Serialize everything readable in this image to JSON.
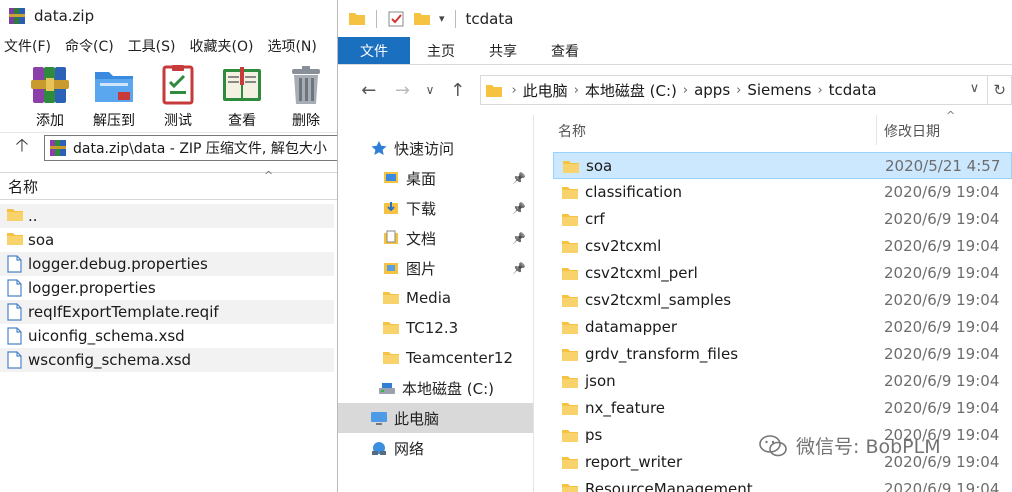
{
  "winrar": {
    "title": "data.zip",
    "menu": [
      "文件(F)",
      "命令(C)",
      "工具(S)",
      "收藏夹(O)",
      "选项(N)"
    ],
    "toolbar": [
      {
        "label": "添加",
        "icon": "add-archive-icon"
      },
      {
        "label": "解压到",
        "icon": "extract-to-icon"
      },
      {
        "label": "测试",
        "icon": "test-archive-icon"
      },
      {
        "label": "查看",
        "icon": "view-book-icon"
      },
      {
        "label": "删除",
        "icon": "delete-trash-icon"
      }
    ],
    "address": "data.zip\\data - ZIP 压缩文件, 解包大小",
    "column_name": "名称",
    "files": [
      {
        "name": "..",
        "icon": "folder-icon"
      },
      {
        "name": "soa",
        "icon": "folder-icon"
      },
      {
        "name": "logger.debug.properties",
        "icon": "file-icon"
      },
      {
        "name": "logger.properties",
        "icon": "file-icon"
      },
      {
        "name": "reqIfExportTemplate.reqif",
        "icon": "file-icon"
      },
      {
        "name": "uiconfig_schema.xsd",
        "icon": "file-icon"
      },
      {
        "name": "wsconfig_schema.xsd",
        "icon": "file-icon"
      }
    ]
  },
  "explorer": {
    "title": "tcdata",
    "ribbon_tabs": [
      "文件",
      "主页",
      "共享",
      "查看"
    ],
    "breadcrumb": [
      "此电脑",
      "本地磁盘 (C:)",
      "apps",
      "Siemens",
      "tcdata"
    ],
    "nav_pane": [
      {
        "label": "快速访问",
        "icon": "star-icon",
        "pinned": false
      },
      {
        "label": "桌面",
        "icon": "desktop-folder-icon",
        "pinned": true
      },
      {
        "label": "下载",
        "icon": "download-folder-icon",
        "pinned": true
      },
      {
        "label": "文档",
        "icon": "documents-folder-icon",
        "pinned": true
      },
      {
        "label": "图片",
        "icon": "pictures-folder-icon",
        "pinned": true
      },
      {
        "label": "Media",
        "icon": "folder-icon",
        "pinned": false
      },
      {
        "label": "TC12.3",
        "icon": "folder-icon",
        "pinned": false
      },
      {
        "label": "Teamcenter12",
        "icon": "folder-icon",
        "pinned": false
      },
      {
        "label": "本地磁盘 (C:)",
        "icon": "drive-icon",
        "pinned": false
      },
      {
        "label": "此电脑",
        "icon": "computer-icon",
        "pinned": false
      },
      {
        "label": "网络",
        "icon": "network-icon",
        "pinned": false
      }
    ],
    "column_name": "名称",
    "column_date": "修改日期",
    "files": [
      {
        "name": "soa",
        "date": "2020/5/21 4:57"
      },
      {
        "name": "classification",
        "date": "2020/6/9 19:04"
      },
      {
        "name": "crf",
        "date": "2020/6/9 19:04"
      },
      {
        "name": "csv2tcxml",
        "date": "2020/6/9 19:04"
      },
      {
        "name": "csv2tcxml_perl",
        "date": "2020/6/9 19:04"
      },
      {
        "name": "csv2tcxml_samples",
        "date": "2020/6/9 19:04"
      },
      {
        "name": "datamapper",
        "date": "2020/6/9 19:04"
      },
      {
        "name": "grdv_transform_files",
        "date": "2020/6/9 19:04"
      },
      {
        "name": "json",
        "date": "2020/6/9 19:04"
      },
      {
        "name": "nx_feature",
        "date": "2020/6/9 19:04"
      },
      {
        "name": "ps",
        "date": "2020/6/9 19:04"
      },
      {
        "name": "report_writer",
        "date": "2020/6/9 19:04"
      },
      {
        "name": "ResourceManagement",
        "date": "2020/6/9 19:04"
      }
    ]
  },
  "watermark": "微信号: BobPLM",
  "colors": {
    "accent": "#1a6fbf",
    "folder": "#f5c242",
    "selected_row": "#cce8ff"
  }
}
